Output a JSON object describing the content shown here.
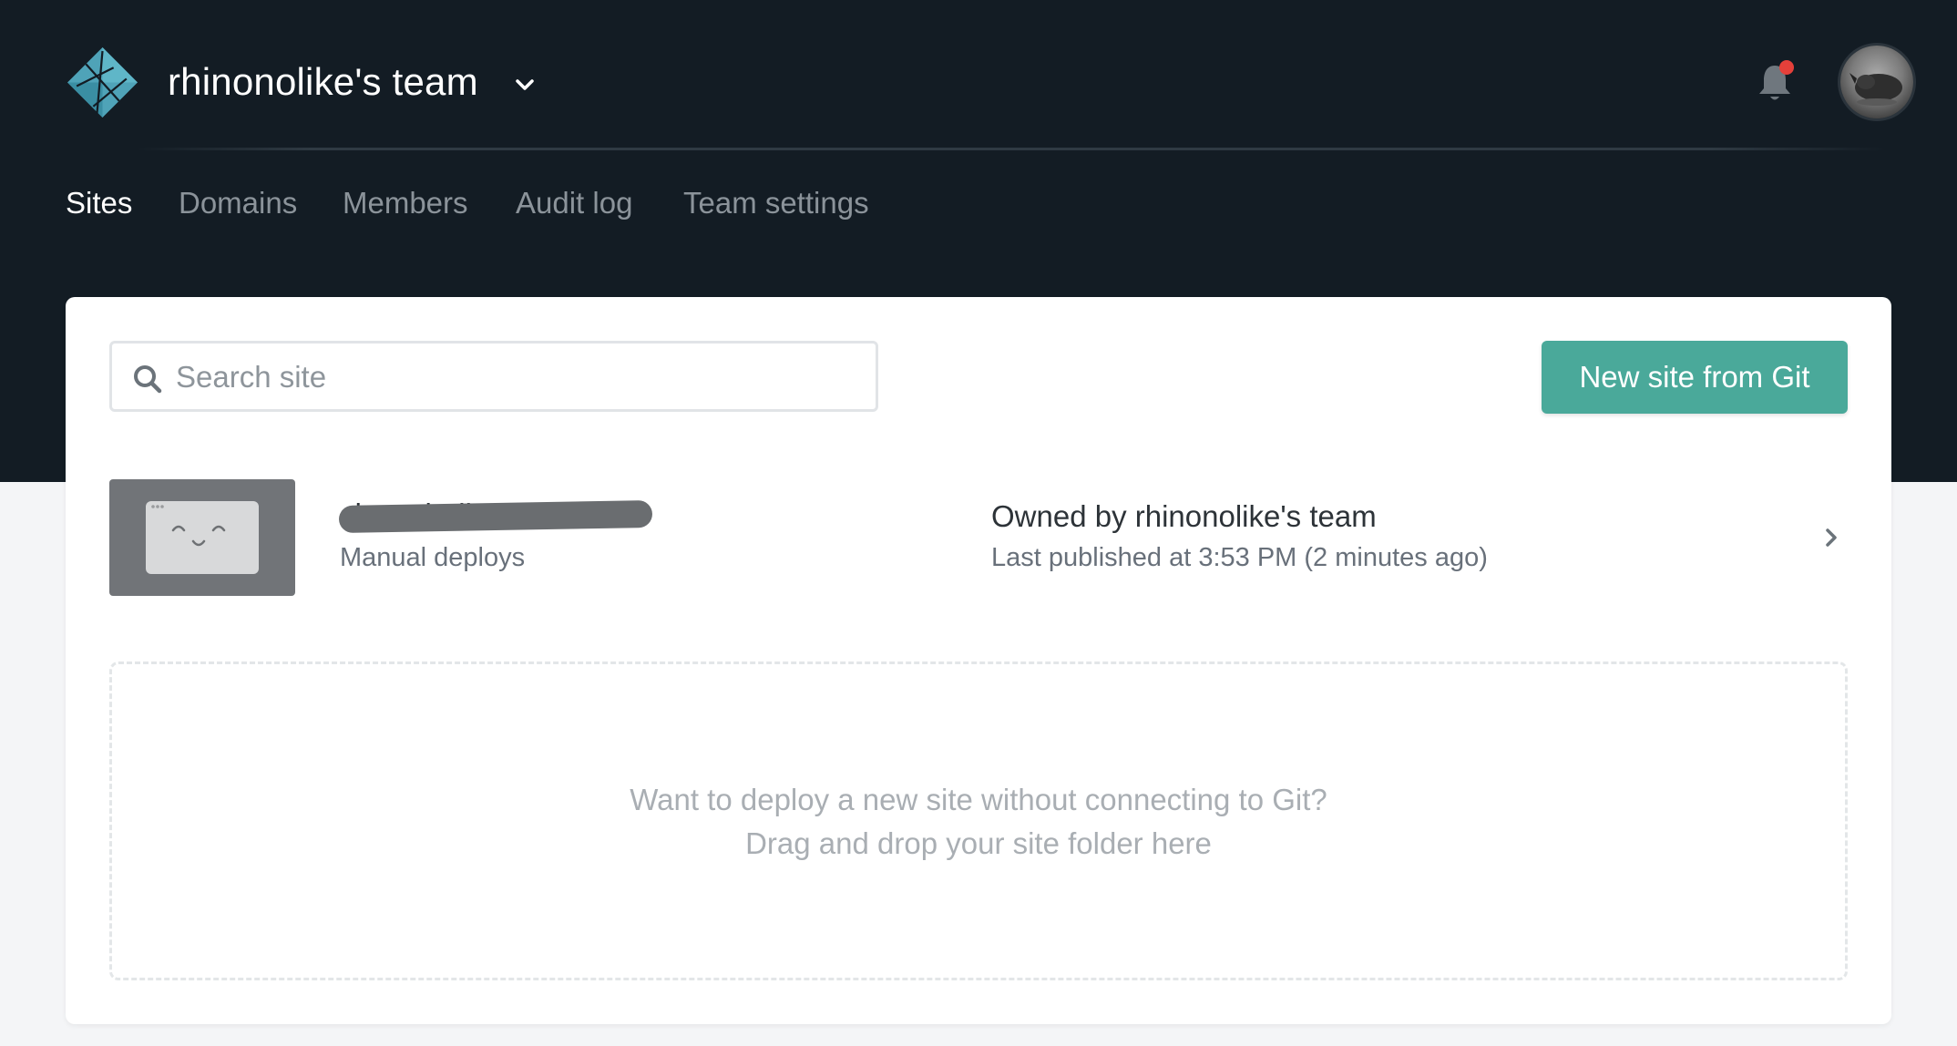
{
  "header": {
    "team_name": "rhinonolike's team",
    "icons": {
      "logo": "netlify-logo",
      "team_menu": "chevron-down-icon",
      "notifications": "bell-icon",
      "avatar": "user-avatar"
    },
    "notification_dot_color": "#e5403a"
  },
  "nav": {
    "tabs": [
      {
        "label": "Sites",
        "active": true
      },
      {
        "label": "Domains",
        "active": false
      },
      {
        "label": "Members",
        "active": false
      },
      {
        "label": "Audit log",
        "active": false
      },
      {
        "label": "Team settings",
        "active": false
      }
    ]
  },
  "toolbar": {
    "search_placeholder": "Search site",
    "search_value": "",
    "new_site_label": "New site from Git"
  },
  "sites": [
    {
      "name": "sharp-bell-49e588",
      "name_redacted": true,
      "deploy_type": "Manual deploys",
      "owner_prefix": "Owned by ",
      "owner": "rhinonolike's team",
      "last_published": "Last published at 3:53 PM (2 minutes ago)"
    }
  ],
  "dropzone": {
    "line1": "Want to deploy a new site without connecting to Git?",
    "line2": "Drag and drop your site folder here"
  },
  "colors": {
    "header_bg": "#131c24",
    "accent": "#4aa99a",
    "page_bg": "#f4f5f7",
    "logo": "#4fa3b8"
  }
}
